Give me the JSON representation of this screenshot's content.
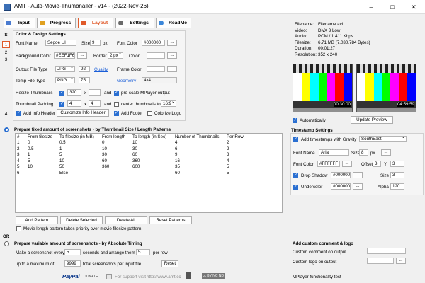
{
  "window": {
    "title": "AMT - Auto-Movie-Thumbnailer - v14 - (2022-Nov-26)",
    "min": "–",
    "max": "□",
    "close": "✕"
  },
  "tabs": [
    {
      "label": "Input",
      "color": "#4a7bd0"
    },
    {
      "label": "Progress",
      "color": "#e0a020"
    },
    {
      "label": "Layout",
      "color": "#e05a2a"
    },
    {
      "label": "Settings",
      "color": "#6a6a6a"
    },
    {
      "label": "ReadMe",
      "color": "#3a86d9"
    }
  ],
  "side_tabs": [
    "S",
    "1",
    "2",
    "3",
    "4"
  ],
  "color_design": {
    "heading": "Color & Design Settings",
    "font_name_label": "Font Name",
    "font_name": "Segoe UI",
    "size_label": "Size",
    "size": "9",
    "px": "px",
    "font_color_label": "Font Color",
    "font_color": "#000000",
    "dots": "...",
    "bg_color_label": "Background Color",
    "bg_color": "#EEF1F6",
    "border_label": "Border",
    "border": "2 px",
    "color_label": "Color",
    "output_label": "Output File Type",
    "output": "JPG",
    "quality_val": "92",
    "quality_label": "Quality",
    "frame_color_label": "Frame Color",
    "temp_label": "Temp File Type",
    "temp": "PNG",
    "temp_val": "75",
    "geometry_label": "Geometry",
    "geometry": "4x4",
    "resize_label": "Resize Thumbnails",
    "resize_w": "320",
    "x": "x",
    "and": "and",
    "prescale_label": "pre-scale MPlayer output",
    "padding_label": "Thumbnail Padding",
    "pad_a": "4",
    "pad_b": "4",
    "center_label": "center thumbnails to",
    "ratio": "16:9",
    "add_info_label": "Add Info Header",
    "customize_label": "Customize Info Header",
    "add_footer_label": "Add Footer",
    "colorize_label": "Colorize Logo"
  },
  "fileinfo": {
    "rows": [
      [
        "Filename:",
        "Filename.avi"
      ],
      [
        "Video:",
        "DivX 3 Low"
      ],
      [
        "Audio:",
        "PCM / 1.411 Kbps"
      ],
      [
        "Filesize:",
        "6.71 MB (7.030.784 Bytes)"
      ],
      [
        "Duration:",
        "00:01:27"
      ],
      [
        "Resolution:",
        "352 x 240"
      ]
    ],
    "time1": "00:30:00",
    "time2": "04:59:59",
    "auto_label": "Automatically",
    "update_label": "Update Preview"
  },
  "fixed": {
    "heading": "Prepare fixed amount of screenshots - by Thumbnail Size / Length Patterns",
    "columns": [
      "#",
      "From filesize",
      "To filesize (in MB)",
      "From length",
      "To length (in Sec)",
      "Number of Thumbnails",
      "Per Row"
    ],
    "rows": [
      [
        "1",
        "0",
        "0.5",
        "0",
        "10",
        "4",
        "2"
      ],
      [
        "2",
        "0.5",
        "1",
        "10",
        "30",
        "6",
        "2"
      ],
      [
        "3",
        "1",
        "5",
        "30",
        "60",
        "9",
        "3"
      ],
      [
        "4",
        "5",
        "10",
        "60",
        "360",
        "16",
        "4"
      ],
      [
        "5",
        "10",
        "50",
        "360",
        "600",
        "35",
        "5"
      ],
      [
        "6",
        "",
        "Else",
        "",
        "",
        "60",
        "5"
      ]
    ],
    "add_label": "Add Pattern",
    "delete_label": "Delete Selected",
    "delete_all_label": "Delete All",
    "reset_label": "Reset Patterns",
    "priority_label": "Movie length pattern takes priority over movie filesize pattern"
  },
  "or_label": "OR",
  "variable": {
    "heading": "Prepare variable amount of screenshots - by Absolute Timing",
    "every_label": "Make a screenshot every",
    "every": "5",
    "arrange_label": "seconds and arrange them",
    "per_row": "5",
    "per_row_label": "per row",
    "max_label": "up to a maximum of",
    "max": "9999",
    "total_label": "total screenshots per input file.",
    "reset_label": "Reset"
  },
  "timestamp": {
    "heading": "Timestamp Settings",
    "add_label": "Add timestamps with Gravity",
    "gravity": "SouthEast",
    "font_name_label": "Font Name",
    "font": "Arial",
    "size_label": "Size",
    "size": "8",
    "px": "px",
    "font_color_label": "Font Color",
    "font_color": "#FFFFFF",
    "offset_label": "Offset",
    "offset_x": "3",
    "y_label": "Y",
    "offset_y": "3",
    "shadow_label": "Drop Shadow",
    "shadow_color": "#000000",
    "shadow_size_label": "Size",
    "shadow_size": "3",
    "undercolor_label": "Undercolor",
    "under_color": "#000000",
    "alpha_label": "Alpha",
    "alpha": "120"
  },
  "custom": {
    "heading": "Add custom comment & logo",
    "comment_label": "Custom comment on output",
    "logo_label": "Custom logo on output"
  },
  "footer": {
    "paypal": "PayPal",
    "donate": "DONATE",
    "support": "For support visit",
    "url": "http://www.amt.cc",
    "license": "cc BY NC ND",
    "mplayer": "MPlayer functionality test"
  }
}
